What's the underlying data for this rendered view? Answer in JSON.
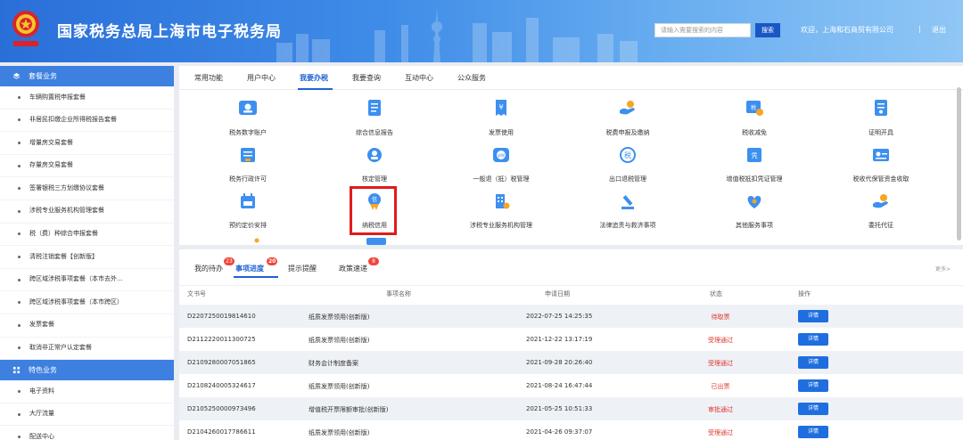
{
  "header": {
    "title": "国家税务总局上海市电子税务局",
    "search_placeholder": "请输入需要搜索的内容",
    "search_button": "搜索",
    "welcome": "欢迎，上海和石商贸有限公司",
    "separator": "|",
    "logout": "退出",
    "brand_color": "#2a6fd8"
  },
  "sidebar": {
    "section1_title": "套餐业务",
    "section1_items": [
      "车辆购置税申报套餐",
      "非居民扣缴企业所得税报告套餐",
      "增量房交易套餐",
      "存量房交易套餐",
      "签署银税三方划缴协议套餐",
      "涉税专业服务机构管理套餐",
      "税（费）种综合申报套餐",
      "清税注销套餐【创新版】",
      "跨区域涉税事项套餐（本市去外…",
      "跨区域涉税事项套餐（本市跨区）",
      "发票套餐",
      "取消非正常户认定套餐"
    ],
    "section2_title": "特色业务",
    "section2_items": [
      "电子资料",
      "大厅流量",
      "配送中心"
    ]
  },
  "tabs": [
    "常用功能",
    "用户中心",
    "我要办税",
    "我要查询",
    "互动中心",
    "公众服务"
  ],
  "active_tab": "我要办税",
  "services": [
    {
      "label": "税务数字账户",
      "icon": "digital-account-icon"
    },
    {
      "label": "综合信息报告",
      "icon": "info-report-icon"
    },
    {
      "label": "发票使用",
      "icon": "invoice-icon"
    },
    {
      "label": "税费申报及缴纳",
      "icon": "tax-declare-icon"
    },
    {
      "label": "税收减免",
      "icon": "tax-reduction-icon"
    },
    {
      "label": "证明开具",
      "icon": "certificate-icon"
    },
    {
      "label": "税务行政许可",
      "icon": "admin-permit-icon"
    },
    {
      "label": "核定管理",
      "icon": "assessment-icon"
    },
    {
      "label": "一般退（抵）税管理",
      "icon": "refund-icon"
    },
    {
      "label": "出口退税管理",
      "icon": "export-refund-icon"
    },
    {
      "label": "增值税抵扣凭证管理",
      "icon": "vat-deduction-icon"
    },
    {
      "label": "税收代保管资金收取",
      "icon": "custody-fund-icon"
    },
    {
      "label": "预约定价安排",
      "icon": "pricing-arrangement-icon"
    },
    {
      "label": "纳税信用",
      "icon": "tax-credit-icon"
    },
    {
      "label": "涉税专业服务机构管理",
      "icon": "agency-management-icon"
    },
    {
      "label": "法律追责与救济事项",
      "icon": "legal-relief-icon"
    },
    {
      "label": "其他服务事项",
      "icon": "other-services-icon"
    },
    {
      "label": "委托代征",
      "icon": "entrusted-collection-icon"
    }
  ],
  "task_tabs": [
    {
      "label": "我的待办",
      "badge": "23"
    },
    {
      "label": "事项进度",
      "badge": "20"
    },
    {
      "label": "提示提醒",
      "badge": ""
    },
    {
      "label": "政策速递",
      "badge": "8"
    }
  ],
  "more_label": "更多>",
  "table": {
    "headers": [
      "文书号",
      "事项名称",
      "申请日期",
      "状态",
      "操作"
    ],
    "rows": [
      {
        "doc": "D2207250019814610",
        "name": "纸质发票领用(创新版)",
        "date": "2022-07-25 14:25:35",
        "status": "待取票",
        "action": "详情"
      },
      {
        "doc": "D2112220011300725",
        "name": "纸质发票领用(创新版)",
        "date": "2021-12-22 13:17:19",
        "status": "受理通过",
        "action": "详情"
      },
      {
        "doc": "D2109280007051865",
        "name": "财务会计制度备案",
        "date": "2021-09-28 20:26:40",
        "status": "受理通过",
        "action": "详情"
      },
      {
        "doc": "D2108240005324617",
        "name": "纸质发票领用(创新版)",
        "date": "2021-08-24 16:47:44",
        "status": "已出票",
        "action": "详情"
      },
      {
        "doc": "D2105250000973496",
        "name": "增值税开票限额审批(创新版)",
        "date": "2021-05-25 10:51:33",
        "status": "审批通过",
        "action": "详情"
      },
      {
        "doc": "D2104260017786611",
        "name": "纸质发票领用(创新版)",
        "date": "2021-04-26 09:37:07",
        "status": "受理通过",
        "action": "详情"
      }
    ]
  },
  "colors": {
    "accent": "#1f62d6",
    "status_red": "#e0362c",
    "highlight": "#e01b1b"
  }
}
